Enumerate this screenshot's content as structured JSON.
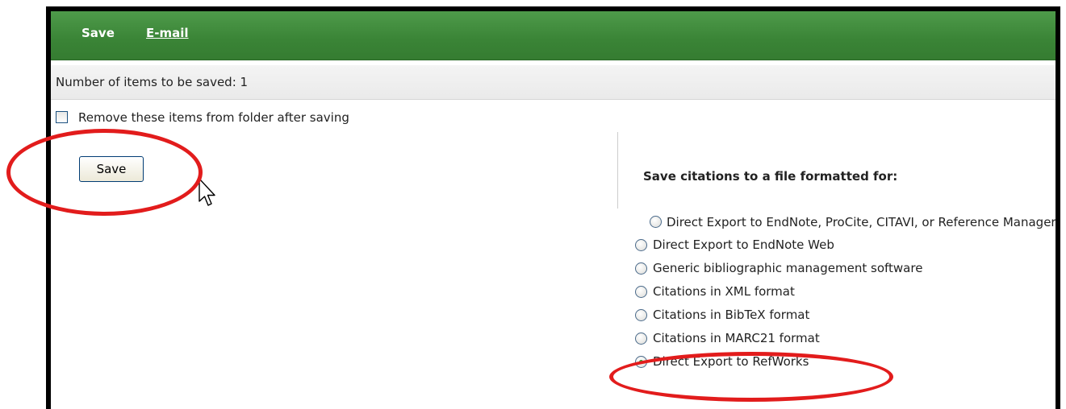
{
  "header": {
    "save_label": "Save",
    "email_label": "E-mail"
  },
  "count_text": "Number of items to be saved: 1",
  "remove_option": {
    "label": "Remove these items from folder after saving",
    "checked": false
  },
  "save_button_label": "Save",
  "export": {
    "title": "Save citations to a file formatted for:",
    "options": [
      {
        "label": "Direct Export to EndNote, ProCite, CITAVI, or Reference Manager",
        "selected": false
      },
      {
        "label": "Direct Export to EndNote Web",
        "selected": false
      },
      {
        "label": "Generic bibliographic management software",
        "selected": false
      },
      {
        "label": "Citations in XML format",
        "selected": false
      },
      {
        "label": "Citations in BibTeX format",
        "selected": false
      },
      {
        "label": "Citations in MARC21 format",
        "selected": false
      },
      {
        "label": "Direct Export to RefWorks",
        "selected": true
      }
    ]
  },
  "colors": {
    "header_green": "#3a8436",
    "annotation_red": "#e21c1c",
    "radio_selected": "#2fa32f"
  }
}
